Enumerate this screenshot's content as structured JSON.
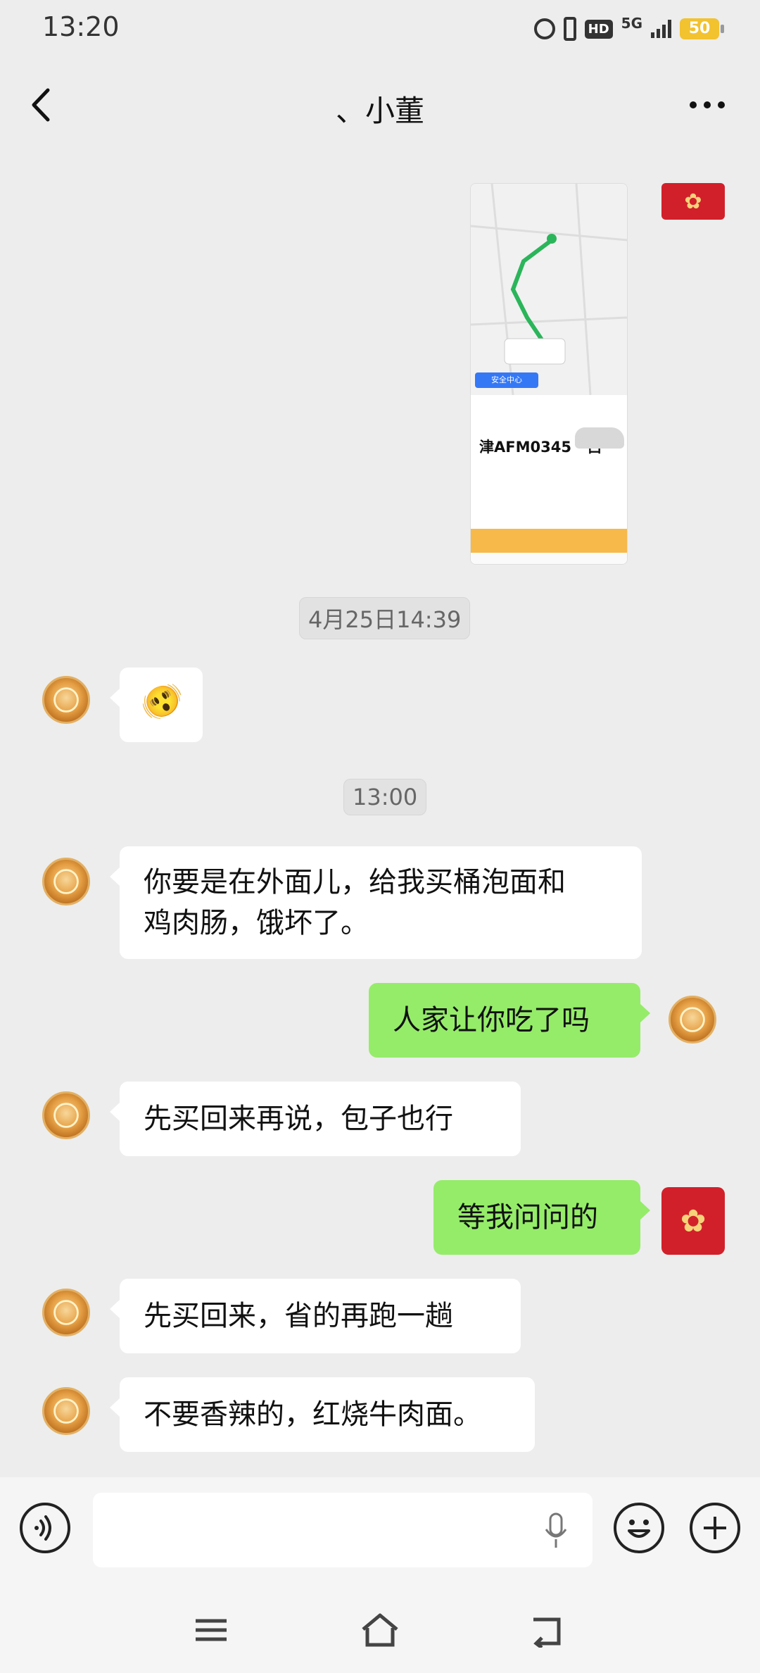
{
  "status_bar": {
    "time": "13:20",
    "hd_label": "HD",
    "network": "5G",
    "battery": "50"
  },
  "header": {
    "title": "、小董",
    "back_icon": "chevron-left-icon",
    "more_icon": "more-dots-icon"
  },
  "screenshot_thumb": {
    "plate": "津AFM0345 · 白",
    "safety_label": "安全中心"
  },
  "messages": [
    {
      "type": "timestamp",
      "text": "4月25日14:39"
    },
    {
      "type": "emoji",
      "side": "left",
      "icon": "thinking-face-emoji",
      "text": "🫨"
    },
    {
      "type": "timestamp",
      "text": "13:00"
    },
    {
      "type": "text",
      "side": "left",
      "line1": "你要是在外面儿，给我买桶泡面和",
      "line2": "鸡肉肠，饿坏了。"
    },
    {
      "type": "text",
      "side": "right",
      "text": "人家让你吃了吗"
    },
    {
      "type": "text",
      "side": "left",
      "text": "先买回来再说，包子也行"
    },
    {
      "type": "text",
      "side": "right",
      "text": "等我问问的"
    },
    {
      "type": "text",
      "side": "left",
      "text": "先买回来，省的再跑一趟"
    },
    {
      "type": "text",
      "side": "left",
      "text": "不要香辣的，红烧牛肉面。"
    }
  ],
  "input_bar": {
    "value": "",
    "placeholder": "",
    "voice_icon": "voice-icon",
    "mic_icon": "mic-icon",
    "emoji_icon": "smiley-icon",
    "plus_icon": "plus-icon"
  },
  "nav_bar": {
    "menu_icon": "menu-icon",
    "home_icon": "home-icon",
    "back_icon": "back-icon"
  },
  "colors": {
    "chat_bg": "#ededed",
    "bubble_in": "#ffffff",
    "bubble_out": "#95ec69",
    "red_avatar": "#d2202a"
  }
}
